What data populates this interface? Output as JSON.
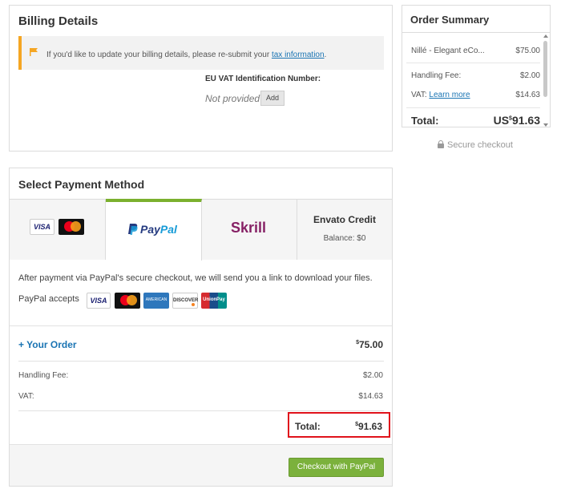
{
  "billing": {
    "title": "Billing Details",
    "notice_text": "If you'd like to update your billing details, please re-submit your ",
    "notice_link": "tax information",
    "notice_end": ".",
    "vat_label": "EU VAT Identification Number:",
    "vat_value": "Not provided",
    "add_label": "Add",
    "accent_color": "#f5a623"
  },
  "payment": {
    "title": "Select Payment Method",
    "tabs": {
      "cards": {
        "visa": "VISA",
        "mastercard": "mastercard"
      },
      "paypal": {
        "pay": "Pay",
        "pal": "Pal"
      },
      "skrill": "Skrill",
      "envato": {
        "title": "Envato Credit",
        "balance": "Balance: $0"
      }
    },
    "active_tab": "PayPal",
    "info_text": "After payment via PayPal's secure checkout, we will send you a link to download your files.",
    "accepts_label": "PayPal accepts",
    "accepted_cards": {
      "visa": "VISA",
      "amex": "AMERICAN EXPRESS",
      "discover": "DISCOVER",
      "unionpay": "UnionPay"
    },
    "your_order_label": "+ Your Order",
    "order_currency": "$",
    "order_amount": "75.00",
    "handling_label": "Handling Fee:",
    "handling_value": "$2.00",
    "vat_label": "VAT:",
    "vat_value": "$14.63",
    "total_label": "Total:",
    "total_currency": "$",
    "total_amount": "91.63",
    "checkout_button": "Checkout with PayPal",
    "button_color": "#7bb13c",
    "highlight_color": "#e0121b"
  },
  "summary": {
    "title": "Order Summary",
    "item_label": "Nillé - Elegant eCo...",
    "item_value": "$75.00",
    "handling_label": "Handling Fee:",
    "handling_value": "$2.00",
    "vat_label": "VAT:",
    "vat_link": "Learn more",
    "vat_value": "$14.63",
    "total_label": "Total:",
    "total_prefix": "US",
    "total_currency": "$",
    "total_amount": "91.63"
  },
  "secure_checkout": "Secure checkout"
}
